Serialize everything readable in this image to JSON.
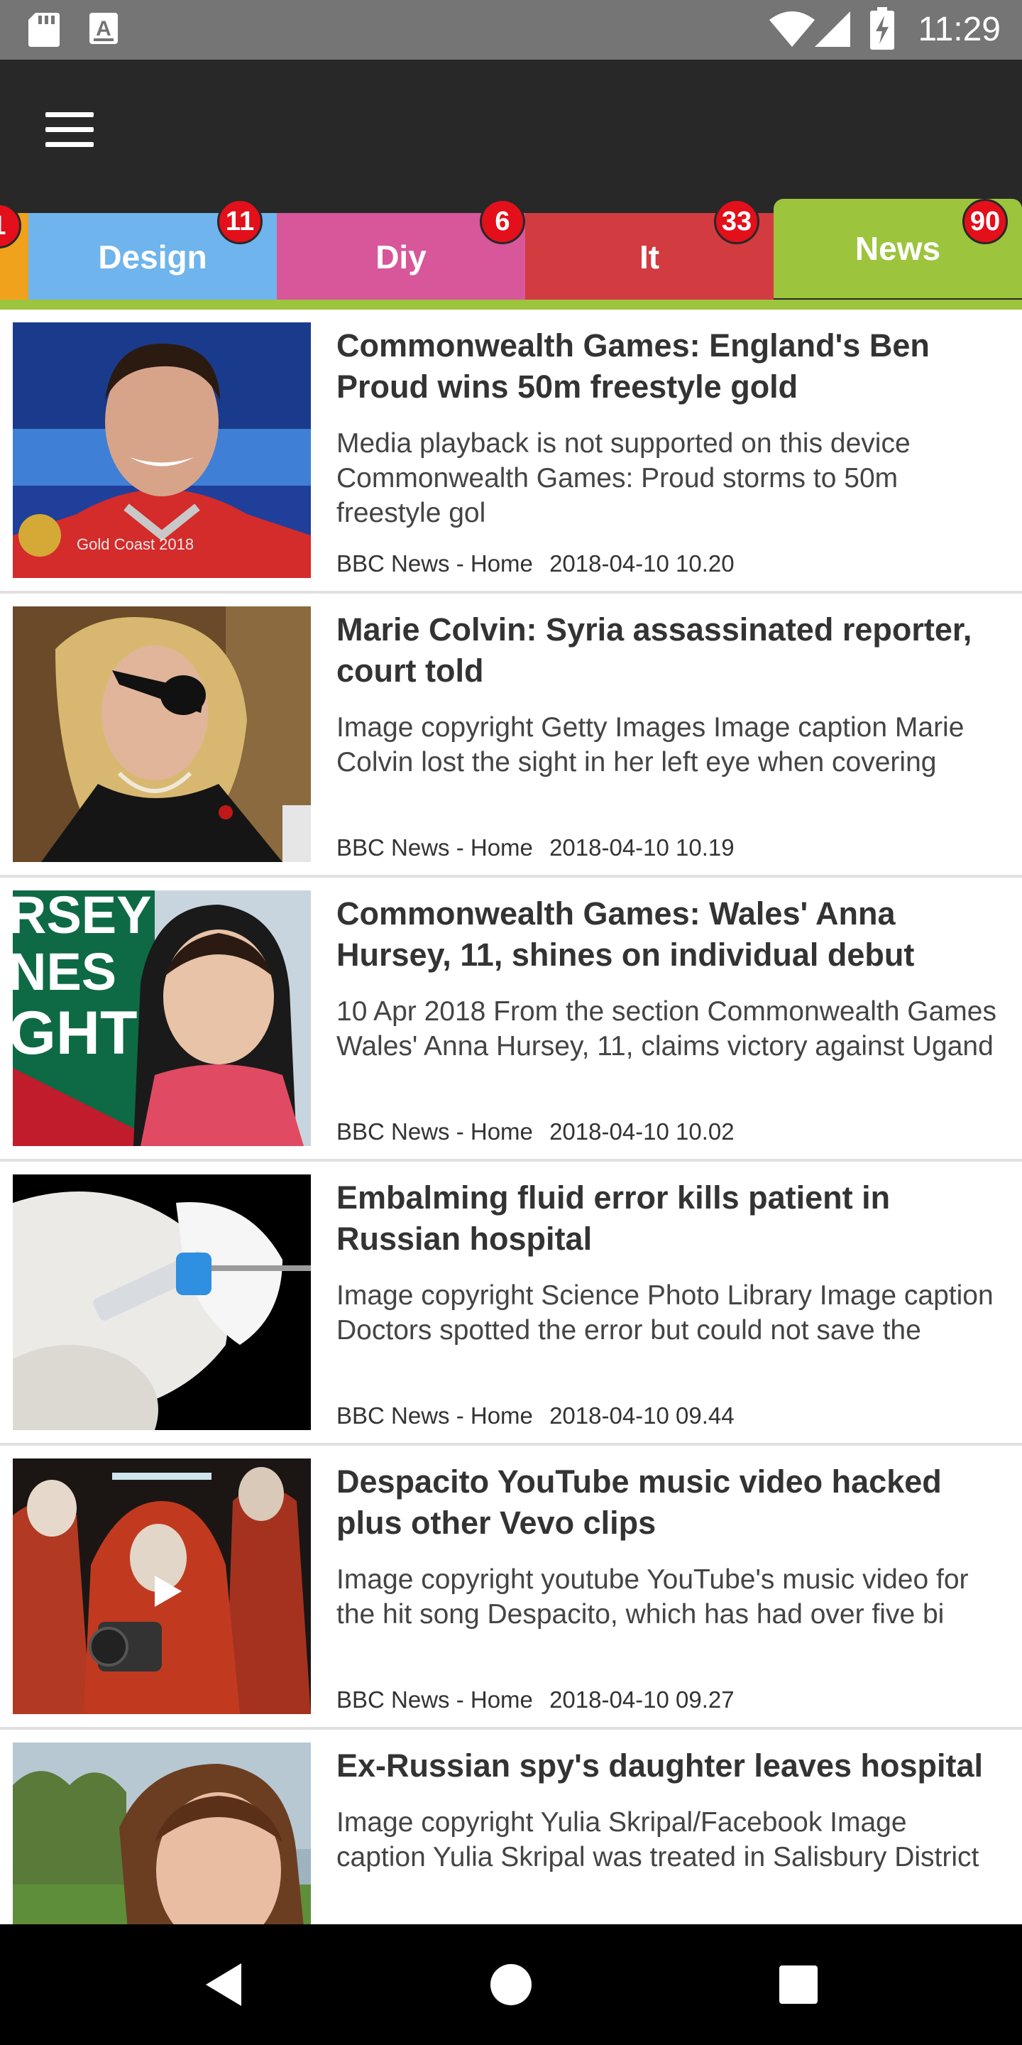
{
  "status_bar": {
    "time": "11:29",
    "left_icons": [
      "sd-card-icon",
      "text-a-icon"
    ],
    "right_icons": [
      "wifi-icon",
      "signal-icon",
      "battery-charging-icon"
    ]
  },
  "tabs": [
    {
      "label": "",
      "badge": "1",
      "color": "#f0a21c",
      "active": false
    },
    {
      "label": "Design",
      "badge": "11",
      "color": "#6fb4ec",
      "active": false
    },
    {
      "label": "Diy",
      "badge": "6",
      "color": "#d7579a",
      "active": false
    },
    {
      "label": "It",
      "badge": "33",
      "color": "#d23b40",
      "active": false
    },
    {
      "label": "News",
      "badge": "90",
      "color": "#9cc43d",
      "active": true
    }
  ],
  "articles": [
    {
      "title": "Commonwealth Games: England's Ben Proud wins 50m freestyle gold",
      "description": "Media playback is not supported on this device Commonwealth Games: Proud storms to 50m freestyle gol",
      "source": "BBC News - Home",
      "date": "2018-04-10 10.20"
    },
    {
      "title": "Marie Colvin: Syria assassinated reporter, court told",
      "description": "Image copyright Getty Images Image caption Marie Colvin lost the sight in her left eye when covering",
      "source": "BBC News - Home",
      "date": "2018-04-10 10.19"
    },
    {
      "title": "Commonwealth Games: Wales' Anna Hursey, 11, shines on individual debut",
      "description": "10 Apr 2018 From the section Commonwealth Games Wales' Anna Hursey, 11, claims victory against Ugand",
      "source": "BBC News - Home",
      "date": "2018-04-10 10.02"
    },
    {
      "title": "Embalming fluid error kills patient in Russian hospital",
      "description": "Image copyright Science Photo Library Image caption Doctors spotted the error but could not save the",
      "source": "BBC News - Home",
      "date": "2018-04-10 09.44"
    },
    {
      "title": "Despacito YouTube music video hacked plus other Vevo clips",
      "description": "Image copyright youtube YouTube's music video for the hit song Despacito, which has had over five bi",
      "source": "BBC News - Home",
      "date": "2018-04-10 09.27"
    },
    {
      "title": "Ex-Russian spy's daughter leaves hospital",
      "description": "Image copyright Yulia Skripal/Facebook Image caption Yulia Skripal was treated in Salisbury District",
      "source": "",
      "date": ""
    }
  ],
  "thumbnail_text": {
    "gold_coast_caption": "Gold Coast 2018",
    "wales_graphic_text": "RSEY NES GHT"
  },
  "nav_bar": [
    "back-icon",
    "home-icon",
    "recents-icon"
  ]
}
